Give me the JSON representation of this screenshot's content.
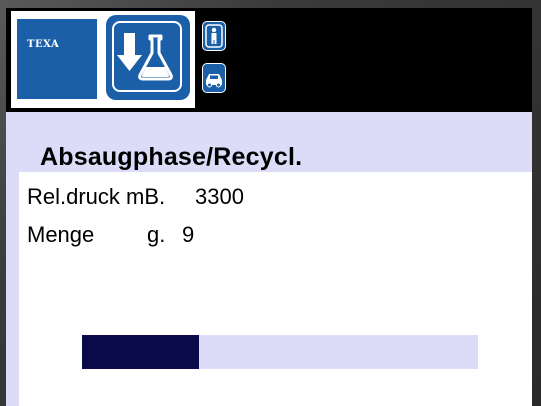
{
  "header": {
    "brand": "TEXA",
    "mode_icon": "recovery-recycle-icon",
    "person_icon": "person-icon",
    "car_icon": "car-icon"
  },
  "phase": {
    "title": "Absaugphase/Recycl."
  },
  "readings": {
    "pressure_label": "Rel.druck mB.",
    "pressure_value": "3300",
    "quantity_label": "Menge",
    "quantity_unit": "g.",
    "quantity_value": "9"
  },
  "progress": {
    "fraction": 0.295
  },
  "colors": {
    "brand_blue": "#1a5fa8",
    "content_bg": "#dcdcf8",
    "progress_fill": "#0a0a4a"
  }
}
